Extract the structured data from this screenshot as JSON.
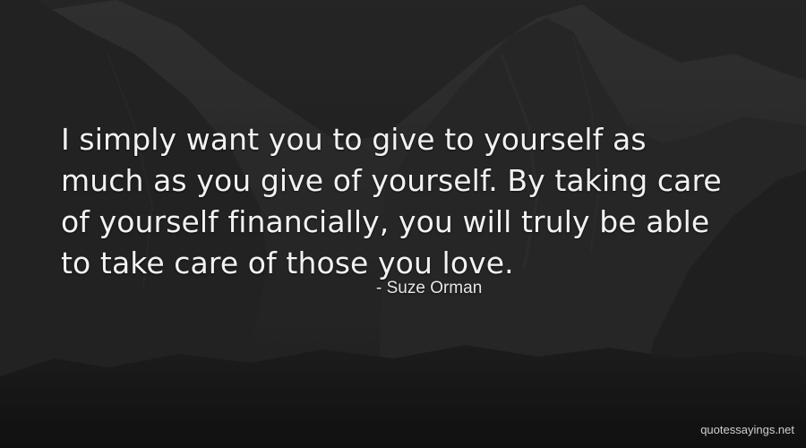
{
  "quote": {
    "lines": [
      "I simply want you to give to yourself as",
      "much as you give of yourself. By taking care",
      "of yourself financially, you will truly be able",
      "to take care of those you love."
    ]
  },
  "author": "- Suze Orman",
  "watermark": "quotessayings.net"
}
